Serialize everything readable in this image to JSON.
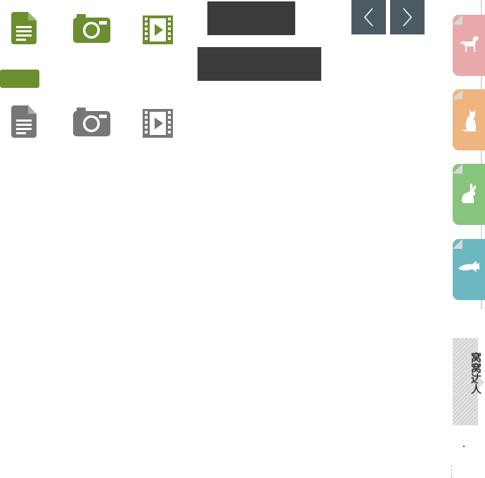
{
  "colors": {
    "green_active": "#6b8e2f",
    "gray_inactive": "#777777",
    "dark_box": "#3b3b3b",
    "nav_button": "#4b5a63",
    "pet_dog": "#e8a9aa",
    "pet_cat": "#f0b47f",
    "pet_rabbit": "#87c47c",
    "pet_fish": "#6bb8c0"
  },
  "icons_active": [
    "document-icon",
    "camera-icon",
    "video-icon"
  ],
  "icons_inactive": [
    "document-icon",
    "camera-icon",
    "video-icon"
  ],
  "nav": {
    "prev_icon": "chevron-left-icon",
    "next_icon": "chevron-right-icon"
  },
  "pet_tabs": [
    "dog-icon",
    "cat-icon",
    "rabbit-icon",
    "fish-icon"
  ],
  "expert_tab": {
    "label": "窝窝达人"
  },
  "footer_dot": "."
}
